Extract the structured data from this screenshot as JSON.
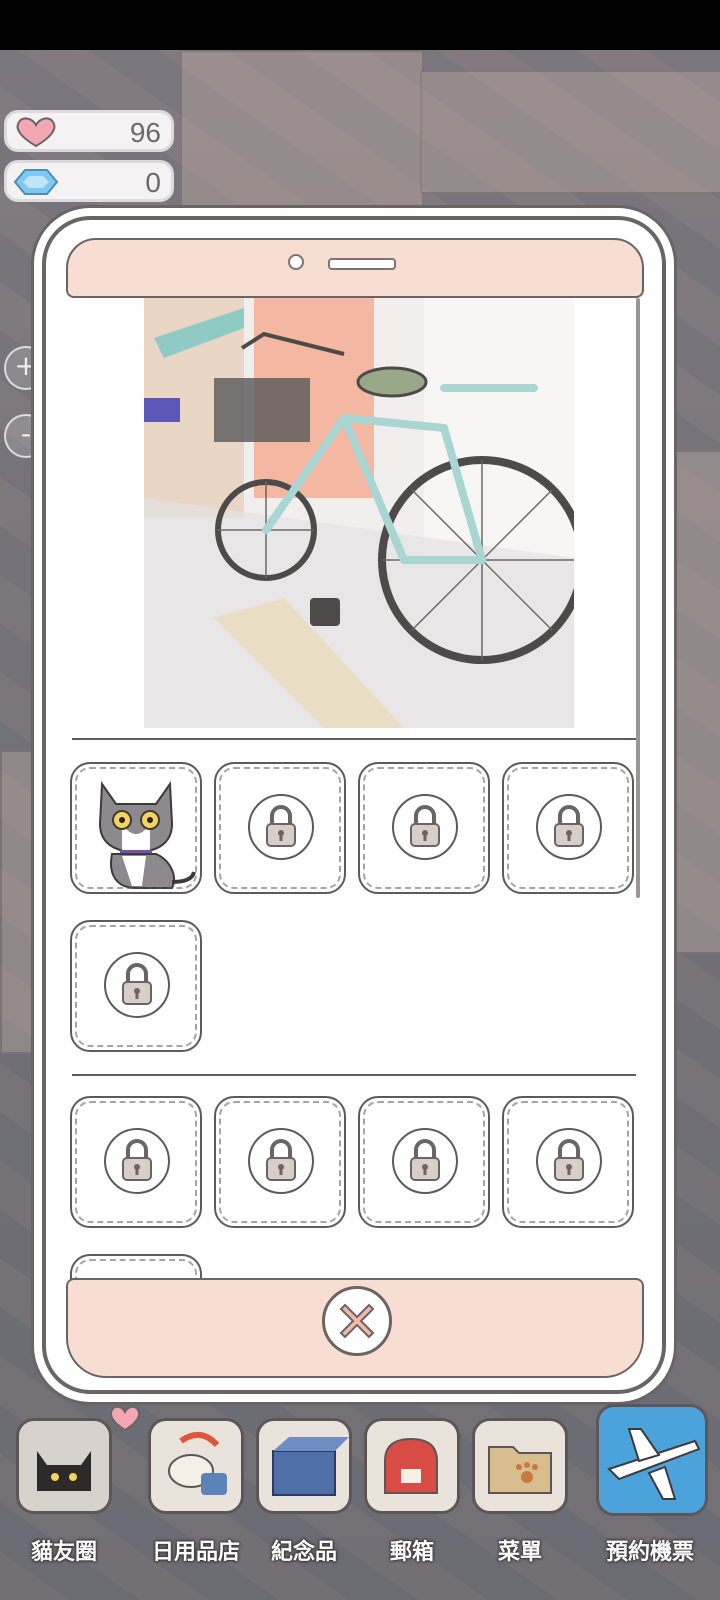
{
  "hud": {
    "hearts": "96",
    "gems": "0",
    "heart_icon": "heart-icon",
    "gem_icon": "diamond-icon",
    "zoom_in": "+",
    "zoom_out": "-"
  },
  "album": {
    "photo": "bicycle-photo",
    "cats_collected": 1,
    "close_icon": "close-icon"
  },
  "nav": {
    "items": [
      {
        "label": "貓友圈",
        "icon": "cat-friends-icon"
      },
      {
        "label": "日用品店",
        "icon": "shop-icon"
      },
      {
        "label": "紀念品",
        "icon": "souvenir-box-icon"
      },
      {
        "label": "郵箱",
        "icon": "mailbox-icon"
      },
      {
        "label": "菜單",
        "icon": "menu-folder-icon"
      },
      {
        "label": "預約機票",
        "icon": "airplane-ticket-icon"
      }
    ]
  },
  "colors": {
    "accent_pink": "#f7ddd2",
    "outline": "#6a6464"
  }
}
